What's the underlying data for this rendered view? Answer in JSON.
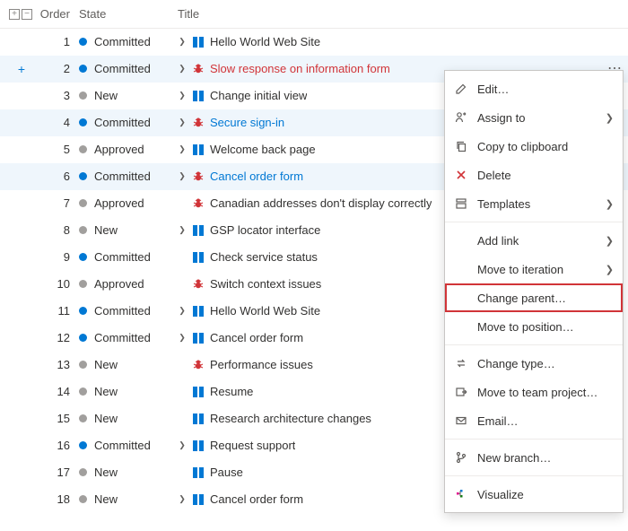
{
  "columns": {
    "order": "Order",
    "state": "State",
    "title": "Title"
  },
  "states": {
    "Committed": {
      "label": "Committed",
      "dot": "dot-blue"
    },
    "New": {
      "label": "New",
      "dot": "dot-grey"
    },
    "Approved": {
      "label": "Approved",
      "dot": "dot-grey"
    }
  },
  "rows": [
    {
      "order": 1,
      "state": "Committed",
      "icon": "book",
      "chev": true,
      "title": "Hello World Web Site",
      "link": false,
      "hl": false,
      "dots": false,
      "add": false
    },
    {
      "order": 2,
      "state": "Committed",
      "icon": "bug",
      "chev": true,
      "title": "Slow response on information form",
      "link": false,
      "red": true,
      "hl": true,
      "dots": true,
      "add": true
    },
    {
      "order": 3,
      "state": "New",
      "icon": "book",
      "chev": true,
      "title": "Change initial view",
      "link": false,
      "hl": false,
      "dots": false,
      "add": false
    },
    {
      "order": 4,
      "state": "Committed",
      "icon": "bug",
      "chev": true,
      "title": "Secure sign-in",
      "link": true,
      "hl": true,
      "dots": true,
      "add": false
    },
    {
      "order": 5,
      "state": "Approved",
      "icon": "book",
      "chev": true,
      "title": "Welcome back page",
      "link": false,
      "hl": false,
      "dots": false,
      "add": false
    },
    {
      "order": 6,
      "state": "Committed",
      "icon": "bug",
      "chev": true,
      "title": "Cancel order form",
      "link": true,
      "hl": true,
      "dots": true,
      "add": false
    },
    {
      "order": 7,
      "state": "Approved",
      "icon": "bug",
      "chev": false,
      "title": "Canadian addresses don't display correctly",
      "link": false,
      "hl": false,
      "dots": false,
      "add": false
    },
    {
      "order": 8,
      "state": "New",
      "icon": "book",
      "chev": true,
      "title": "GSP locator interface",
      "link": false,
      "hl": false,
      "dots": false,
      "add": false
    },
    {
      "order": 9,
      "state": "Committed",
      "icon": "book",
      "chev": false,
      "title": "Check service status",
      "link": false,
      "hl": false,
      "dots": false,
      "add": false
    },
    {
      "order": 10,
      "state": "Approved",
      "icon": "bug",
      "chev": false,
      "title": "Switch context issues",
      "link": false,
      "hl": false,
      "dots": false,
      "add": false
    },
    {
      "order": 11,
      "state": "Committed",
      "icon": "book",
      "chev": true,
      "title": "Hello World Web Site",
      "link": false,
      "hl": false,
      "dots": false,
      "add": false
    },
    {
      "order": 12,
      "state": "Committed",
      "icon": "book",
      "chev": true,
      "title": "Cancel order form",
      "link": false,
      "hl": false,
      "dots": false,
      "add": false
    },
    {
      "order": 13,
      "state": "New",
      "icon": "bug",
      "chev": false,
      "title": "Performance issues",
      "link": false,
      "hl": false,
      "dots": false,
      "add": false
    },
    {
      "order": 14,
      "state": "New",
      "icon": "book",
      "chev": false,
      "title": "Resume",
      "link": false,
      "hl": false,
      "dots": false,
      "add": false
    },
    {
      "order": 15,
      "state": "New",
      "icon": "book",
      "chev": false,
      "title": "Research architecture changes",
      "link": false,
      "hl": false,
      "dots": false,
      "add": false
    },
    {
      "order": 16,
      "state": "Committed",
      "icon": "book",
      "chev": true,
      "title": "Request support",
      "link": false,
      "hl": false,
      "dots": false,
      "add": false
    },
    {
      "order": 17,
      "state": "New",
      "icon": "book",
      "chev": false,
      "title": "Pause",
      "link": false,
      "hl": false,
      "dots": false,
      "add": false
    },
    {
      "order": 18,
      "state": "New",
      "icon": "book",
      "chev": true,
      "title": "Cancel order form",
      "link": false,
      "hl": false,
      "dots": false,
      "add": false
    }
  ],
  "menu": [
    {
      "type": "item",
      "icon": "edit",
      "label": "Edit…",
      "sub": false
    },
    {
      "type": "item",
      "icon": "assign",
      "label": "Assign to",
      "sub": true
    },
    {
      "type": "item",
      "icon": "copy",
      "label": "Copy to clipboard",
      "sub": false
    },
    {
      "type": "item",
      "icon": "delete",
      "label": "Delete",
      "sub": false,
      "danger": true
    },
    {
      "type": "item",
      "icon": "templates",
      "label": "Templates",
      "sub": true
    },
    {
      "type": "sep"
    },
    {
      "type": "item",
      "icon": "",
      "label": "Add link",
      "sub": true,
      "noicon": true
    },
    {
      "type": "item",
      "icon": "",
      "label": "Move to iteration",
      "sub": true,
      "noicon": true
    },
    {
      "type": "item",
      "icon": "",
      "label": "Change parent…",
      "sub": false,
      "noicon": true,
      "highlighted": true
    },
    {
      "type": "item",
      "icon": "",
      "label": "Move to position…",
      "sub": false,
      "noicon": true
    },
    {
      "type": "sep"
    },
    {
      "type": "item",
      "icon": "change",
      "label": "Change type…",
      "sub": false
    },
    {
      "type": "item",
      "icon": "moveproj",
      "label": "Move to team project…",
      "sub": false
    },
    {
      "type": "item",
      "icon": "email",
      "label": "Email…",
      "sub": false
    },
    {
      "type": "sep"
    },
    {
      "type": "item",
      "icon": "branch",
      "label": "New branch…",
      "sub": false
    },
    {
      "type": "sep"
    },
    {
      "type": "item",
      "icon": "visualize",
      "label": "Visualize",
      "sub": false
    }
  ]
}
